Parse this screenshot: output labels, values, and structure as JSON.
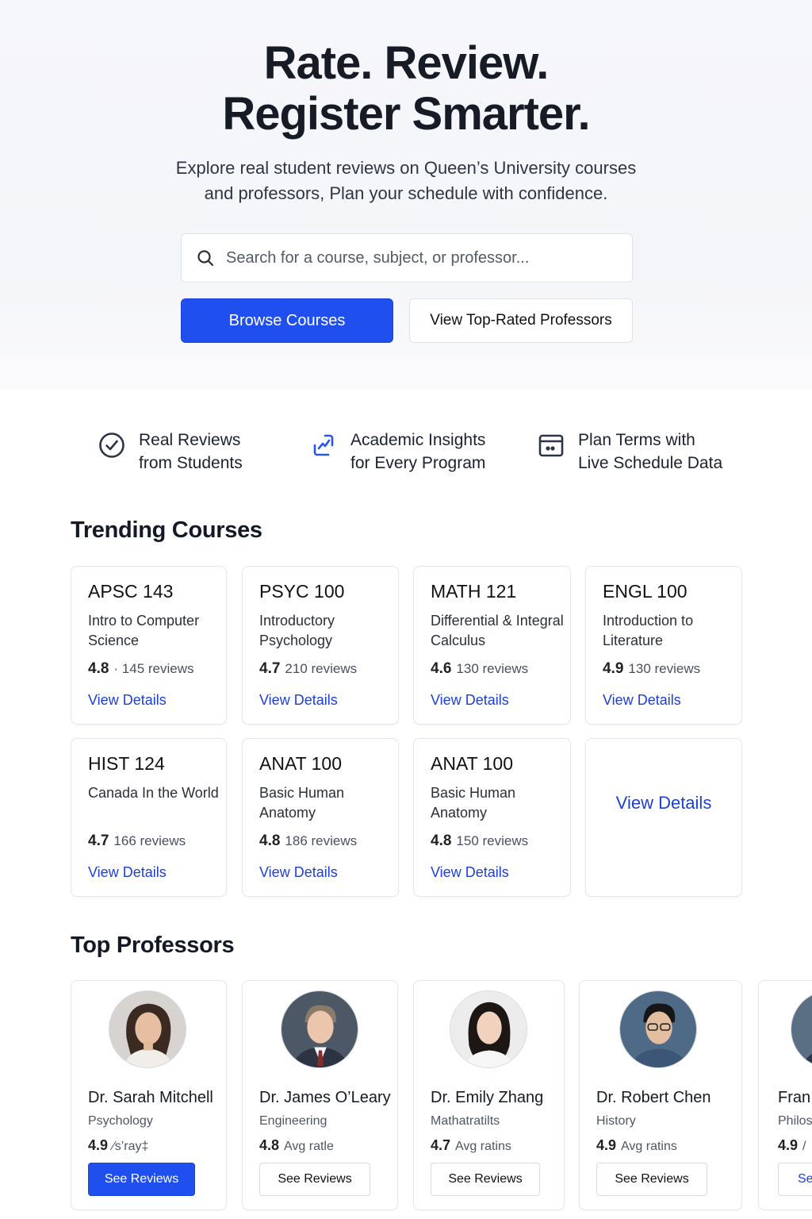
{
  "hero": {
    "title_line1": "Rate. Review.",
    "title_line2": "Register Smarter.",
    "subtitle_line1": "Explore real student reviews on Queen’s University courses",
    "subtitle_line2": "and professors, Plan your schedule with confidence.",
    "search_placeholder": "Search for a course, subject, or professor...",
    "browse_label": "Browse Courses",
    "top_rated_label": "View Top-Rated Professors"
  },
  "features": [
    {
      "line1": "Real Reviews",
      "line2": "from Students",
      "icon": "check-circle-icon"
    },
    {
      "line1": "Academic Insights",
      "line2": "for Every Program",
      "icon": "insights-icon"
    },
    {
      "line1": "Plan Terms with",
      "line2": "Live Schedule Data",
      "icon": "calendar-icon"
    }
  ],
  "trending": {
    "title": "Trending Courses",
    "courses": [
      {
        "code": "APSC 143",
        "name": "Intro to Computer Science",
        "rating": "4.8",
        "reviews": "· 145 reviews",
        "link": "View Details"
      },
      {
        "code": "PSYC 100",
        "name": "Introductory Psychology",
        "rating": "4.7",
        "reviews": "210 reviews",
        "link": "View Details"
      },
      {
        "code": "MATH 121",
        "name": "Differential & Integral Calculus",
        "rating": "4.6",
        "reviews": "130 reviews",
        "link": "View Details"
      },
      {
        "code": "ENGL 100",
        "name": "Introduction to Literature",
        "rating": "4.9",
        "reviews": "130 reviews",
        "link": "View Details"
      },
      {
        "code": "HIST 124",
        "name": "Canada In the World",
        "rating": "4.7",
        "reviews": "166 reviews",
        "link": "View Details"
      },
      {
        "code": "ANAT 100",
        "name": "Basic Human Anatomy",
        "rating": "4.8",
        "reviews": "186 reviews",
        "link": "View Details"
      },
      {
        "code": "ANAT 100",
        "name": "Basic Human Anatomy",
        "rating": "4.8",
        "reviews": "150 reviews",
        "link": "View Details"
      }
    ],
    "extra_link": "View Details"
  },
  "professors": {
    "title": "Top Professors",
    "items": [
      {
        "name": "Dr. Sarah Mitchell",
        "dept": "Psychology",
        "rating": "4.9",
        "rating_label": "⁄s’ray‡",
        "button": "See Reviews"
      },
      {
        "name": "Dr. James O’Leary",
        "dept": "Engineering",
        "rating": "4.8",
        "rating_label": "Avg ratle",
        "button": "See Reviews"
      },
      {
        "name": "Dr. Emily Zhang",
        "dept": "Mathatratilts",
        "rating": "4.7",
        "rating_label": "Avg ratins",
        "button": "See Reviews"
      },
      {
        "name": "Dr. Robert Chen",
        "dept": "History",
        "rating": "4.9",
        "rating_label": "Avg ratins",
        "button": "See Reviews"
      },
      {
        "name": "Fran",
        "dept": "Philos",
        "rating": "4.9",
        "rating_label": "/",
        "button": "Se"
      }
    ]
  },
  "colors": {
    "primary": "#1f4fee",
    "link": "#1d3fd6",
    "heading": "#161b26"
  }
}
